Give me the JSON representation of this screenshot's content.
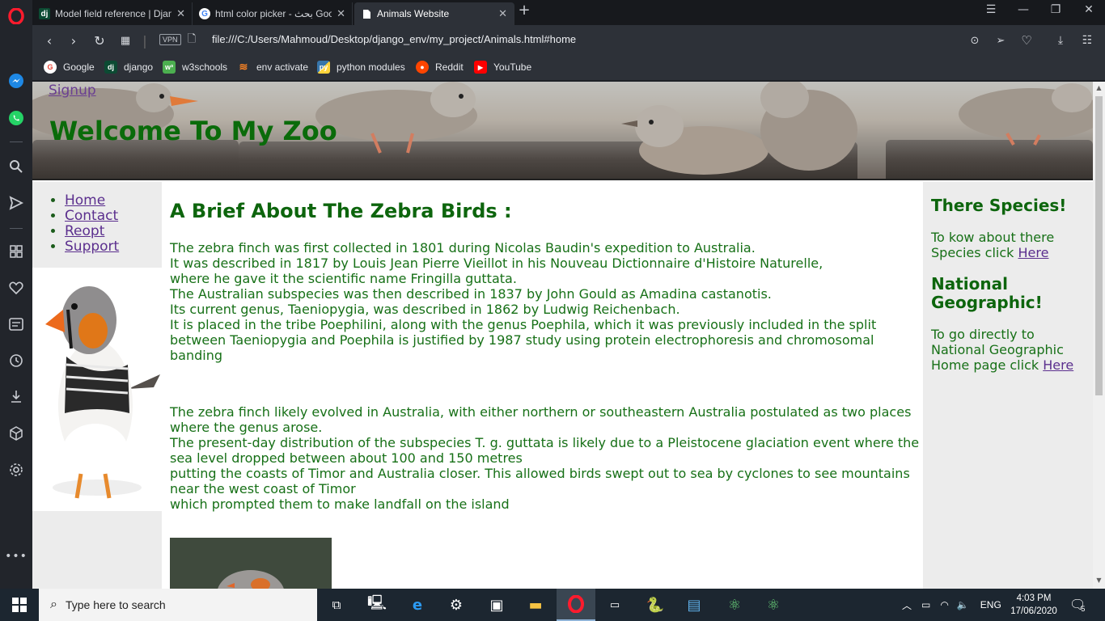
{
  "browser": {
    "tabs": [
      {
        "favicon": "dj",
        "title": "Model field reference | Djan"
      },
      {
        "favicon": "G",
        "title": "html color picker - بحث Goo"
      },
      {
        "favicon": "doc",
        "title": "Animals Website"
      }
    ],
    "url": "file:///C:/Users/Mahmoud/Desktop/django_env/my_project/Animals.html#home",
    "vpn_label": "VPN",
    "bookmarks": [
      {
        "label": "Google",
        "icon": "google-icon",
        "color": "#ffffff"
      },
      {
        "label": "django",
        "icon": "django-icon",
        "color": "#0c4b33"
      },
      {
        "label": "w3schools",
        "icon": "w3schools-icon",
        "color": "#4caf50"
      },
      {
        "label": "env activate",
        "icon": "stackoverflow-icon",
        "color": "#f48024"
      },
      {
        "label": "python modules",
        "icon": "python-icon",
        "color": "#3776ab"
      },
      {
        "label": "Reddit",
        "icon": "reddit-icon",
        "color": "#ff4500"
      },
      {
        "label": "YouTube",
        "icon": "youtube-icon",
        "color": "#ff0000"
      }
    ]
  },
  "page": {
    "signup": "Signup",
    "title": "Welcome To My Zoo",
    "nav": [
      "Home",
      "Contact",
      "Reopt",
      "Support"
    ],
    "heading": "A Brief About The Zebra Birds :",
    "paragraph1": [
      "The zebra finch was first collected in 1801 during Nicolas Baudin's expedition to Australia.",
      "It was described in 1817 by Louis Jean Pierre Vieillot in his Nouveau Dictionnaire d'Histoire Naturelle,",
      "where he gave it the scientific name Fringilla guttata.",
      "The Australian subspecies was then described in 1837 by John Gould as Amadina castanotis.",
      "Its current genus, Taeniopygia, was described in 1862 by Ludwig Reichenbach.",
      "It is placed in the tribe Poephilini, along with the genus Poephila, which it was previously included in the split between Taeniopygia and Poephila is justified by 1987 study using protein electrophoresis and chromosomal banding"
    ],
    "paragraph2": [
      "The zebra finch likely evolved in Australia, with either northern or southeastern Australia postulated as two places where the genus arose.",
      "The present-day distribution of the subspecies T. g. guttata is likely due to a Pleistocene glaciation event where the sea level dropped between about 100 and 150 metres",
      "putting the coasts of Timor and Australia closer. This allowed birds swept out to sea by cyclones to see mountains near the west coast of Timor",
      "which prompted them to make landfall on the island"
    ],
    "aside": {
      "species_heading": "There Species!",
      "species_text": "To kow about there Species click",
      "species_link": "Here",
      "natgeo_heading": "National Geographic!",
      "natgeo_text": "To go directly to National Geographic Home page click",
      "natgeo_link": "Here"
    }
  },
  "taskbar": {
    "search_placeholder": "Type here to search",
    "language": "ENG",
    "time": "4:03 PM",
    "date": "17/06/2020",
    "notifications": "5"
  }
}
